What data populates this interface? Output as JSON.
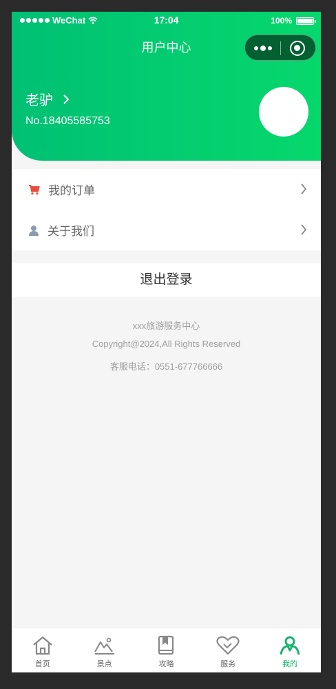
{
  "status_bar": {
    "carrier": "WeChat",
    "time": "17:04",
    "battery": "100%"
  },
  "nav": {
    "title": "用户中心"
  },
  "user": {
    "name": "老驴",
    "number": "No.18405585753"
  },
  "menu": [
    {
      "label": "我的订单",
      "icon": "cart-icon"
    },
    {
      "label": "关于我们",
      "icon": "user-icon"
    }
  ],
  "logout_label": "退出登录",
  "footer": {
    "line1": "xxx旅游服务中心",
    "line2": "Copyright@2024,All Rights Reserved",
    "line3": "客服电话：0551-677766666"
  },
  "tabs": [
    {
      "label": "首页",
      "icon": "home-icon"
    },
    {
      "label": "景点",
      "icon": "scenery-icon"
    },
    {
      "label": "攻略",
      "icon": "guide-book-icon"
    },
    {
      "label": "服务",
      "icon": "service-heart-icon"
    },
    {
      "label": "我的",
      "icon": "profile-icon",
      "active": true
    }
  ],
  "colors": {
    "primary": "#06d86c",
    "primary_dark": "#00c074",
    "active_tab": "#17b46b",
    "cart": "#e74c3c"
  }
}
